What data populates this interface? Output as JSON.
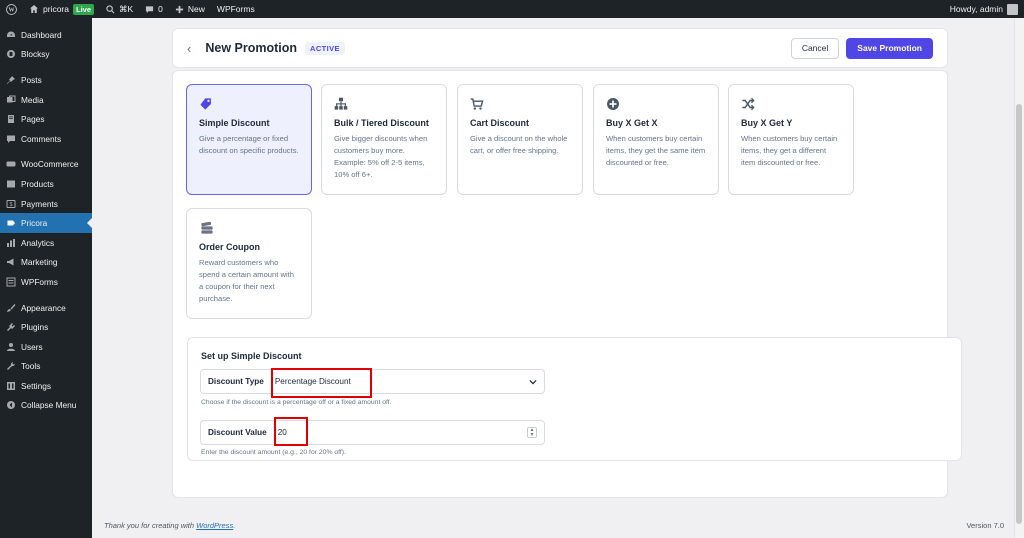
{
  "admin_bar": {
    "site_name": "pricora",
    "live_badge": "Live",
    "search_shortcut": "⌘K",
    "comments_count": "0",
    "new_label": "New",
    "wpforms_label": "WPForms",
    "greeting": "Howdy, admin"
  },
  "sidebar": {
    "items": [
      {
        "label": "Dashboard",
        "icon": "dashboard-icon"
      },
      {
        "label": "Blocksy",
        "icon": "blocksy-icon"
      },
      {
        "label": "Posts",
        "icon": "pin-icon"
      },
      {
        "label": "Media",
        "icon": "media-icon"
      },
      {
        "label": "Pages",
        "icon": "pages-icon"
      },
      {
        "label": "Comments",
        "icon": "comments-icon"
      },
      {
        "label": "WooCommerce",
        "icon": "woocommerce-icon"
      },
      {
        "label": "Products",
        "icon": "products-icon"
      },
      {
        "label": "Payments",
        "icon": "payments-icon"
      },
      {
        "label": "Pricora",
        "icon": "pricora-icon"
      },
      {
        "label": "Analytics",
        "icon": "analytics-icon"
      },
      {
        "label": "Marketing",
        "icon": "megaphone-icon"
      },
      {
        "label": "WPForms",
        "icon": "wpforms-icon"
      },
      {
        "label": "Appearance",
        "icon": "brush-icon"
      },
      {
        "label": "Plugins",
        "icon": "plugin-icon"
      },
      {
        "label": "Users",
        "icon": "users-icon"
      },
      {
        "label": "Tools",
        "icon": "wrench-icon"
      },
      {
        "label": "Settings",
        "icon": "settings-icon"
      },
      {
        "label": "Collapse Menu",
        "icon": "collapse-icon"
      }
    ]
  },
  "header": {
    "title": "New Promotion",
    "status_badge": "ACTIVE",
    "cancel_label": "Cancel",
    "save_label": "Save Promotion"
  },
  "promotion_types": [
    {
      "name": "Simple Discount",
      "desc": "Give a percentage or fixed discount on specific products.",
      "icon": "tag-icon",
      "selected": true
    },
    {
      "name": "Bulk / Tiered Discount",
      "desc": "Give bigger discounts when customers buy more. Example: 5% off 2-5 items, 10% off 6+.",
      "icon": "hierarchy-icon",
      "selected": false
    },
    {
      "name": "Cart Discount",
      "desc": "Give a discount on the whole cart, or offer free shipping.",
      "icon": "cart-icon",
      "selected": false
    },
    {
      "name": "Buy X Get X",
      "desc": "When customers buy certain items, they get the same item discounted or free.",
      "icon": "plus-circle-icon",
      "selected": false
    },
    {
      "name": "Buy X Get Y",
      "desc": "When customers buy certain items, they get a different item discounted or free.",
      "icon": "shuffle-icon",
      "selected": false
    },
    {
      "name": "Order Coupon",
      "desc": "Reward customers who spend a certain amount with a coupon for their next purchase.",
      "icon": "coupon-icon",
      "selected": false
    }
  ],
  "setup": {
    "title": "Set up Simple Discount",
    "discount_type_label": "Discount Type",
    "discount_type_value": "Percentage Discount",
    "discount_type_help": "Choose if the discount is a percentage off or a fixed amount off.",
    "discount_value_label": "Discount Value",
    "discount_value": "20",
    "discount_value_help": "Enter the discount amount (e.g., 20 for 20% off)."
  },
  "footer": {
    "thanks_prefix": "Thank you for creating with ",
    "wordpress_link": "WordPress",
    "thanks_suffix": ".",
    "version": "Version 7.0"
  },
  "colors": {
    "accent": "#4f46e5",
    "admin_dark": "#1d2327",
    "active_menu": "#2271b1",
    "highlight_box": "#e00000"
  }
}
